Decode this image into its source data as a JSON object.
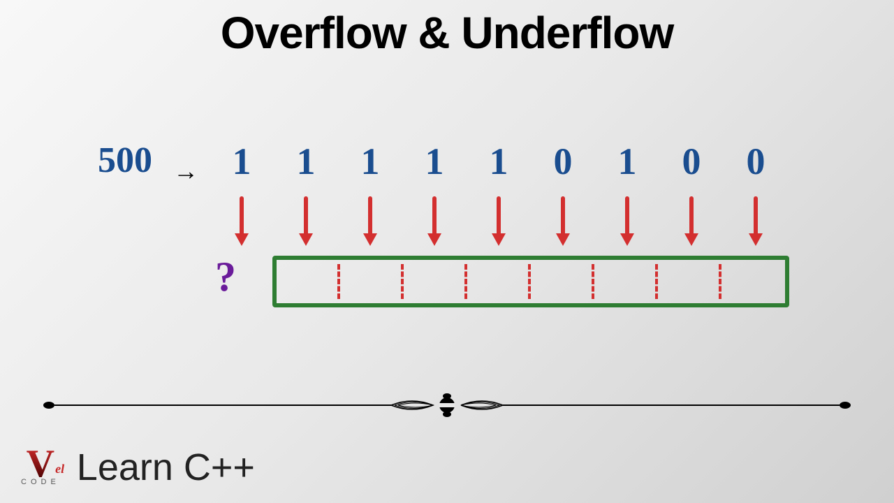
{
  "title": "Overflow & Underflow",
  "diagram": {
    "decimal_value": "500",
    "bits": [
      "1",
      "1",
      "1",
      "1",
      "1",
      "0",
      "1",
      "0",
      "0"
    ],
    "overflow_symbol": "?",
    "box_cells": 8
  },
  "footer": {
    "logo_main": "V",
    "logo_sub": "el",
    "logo_caption": "CODE",
    "course_title": "Learn C++"
  },
  "colors": {
    "bit_color": "#1a4d8f",
    "arrow_color": "#d32f2f",
    "box_color": "#2e7d32",
    "question_color": "#6a1b9a"
  }
}
